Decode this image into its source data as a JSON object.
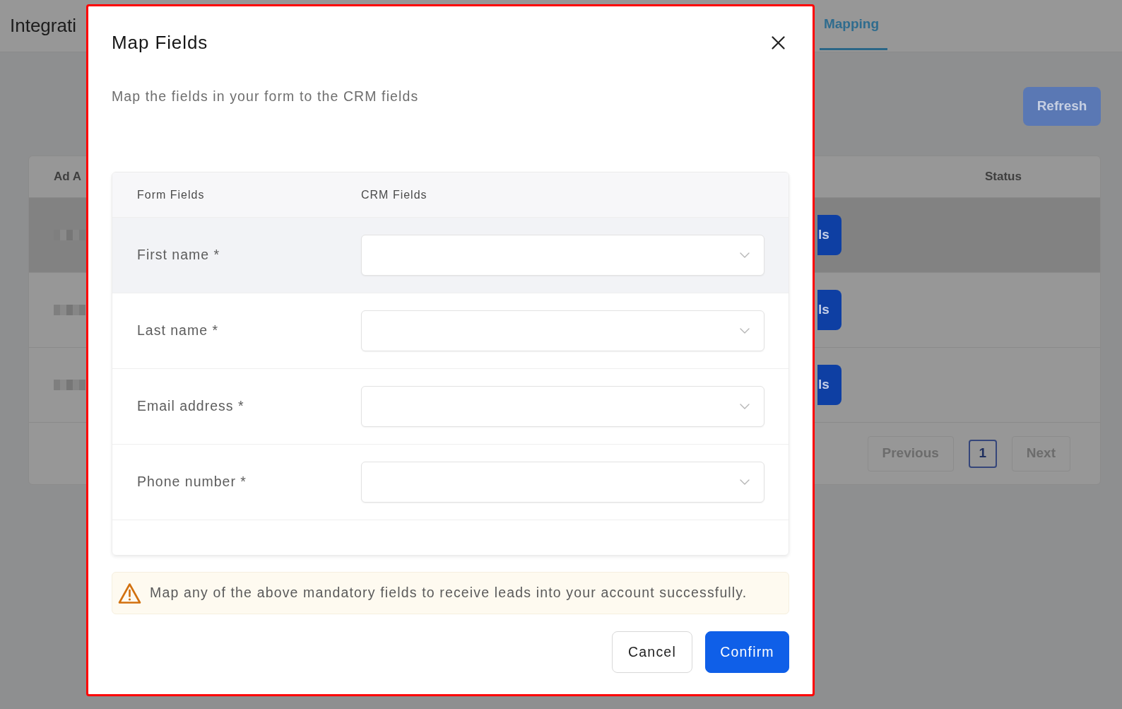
{
  "background": {
    "page_title": "Integrati",
    "tabs": [
      {
        "label": "Mapping",
        "selected": true
      }
    ],
    "refresh_button": "Refresh",
    "table": {
      "columns": [
        "Ad A",
        "Status"
      ],
      "rows": [
        {
          "button": "ls",
          "highlighted": true
        },
        {
          "button": "ls",
          "highlighted": false
        },
        {
          "button": "ls",
          "highlighted": false
        }
      ]
    },
    "pagination": {
      "previous": "Previous",
      "pages": [
        {
          "label": "1",
          "selected": true
        }
      ],
      "next": "Next"
    }
  },
  "dialog": {
    "highlighted": true,
    "title": "Map Fields",
    "subtitle": "Map the fields in your form to the CRM fields",
    "table": {
      "columns": [
        "Form Fields",
        "CRM Fields"
      ],
      "rows": [
        {
          "label": "First name *",
          "hovered": true
        },
        {
          "label": "Last name *",
          "hovered": false
        },
        {
          "label": "Email address *",
          "hovered": false
        },
        {
          "label": "Phone number *",
          "hovered": false
        }
      ]
    },
    "warning": "Map any of the above mandatory fields to receive leads into your account successfully.",
    "buttons": [
      {
        "label": "Cancel",
        "kind": "secondary"
      },
      {
        "label": "Confirm",
        "kind": "primary"
      }
    ]
  }
}
